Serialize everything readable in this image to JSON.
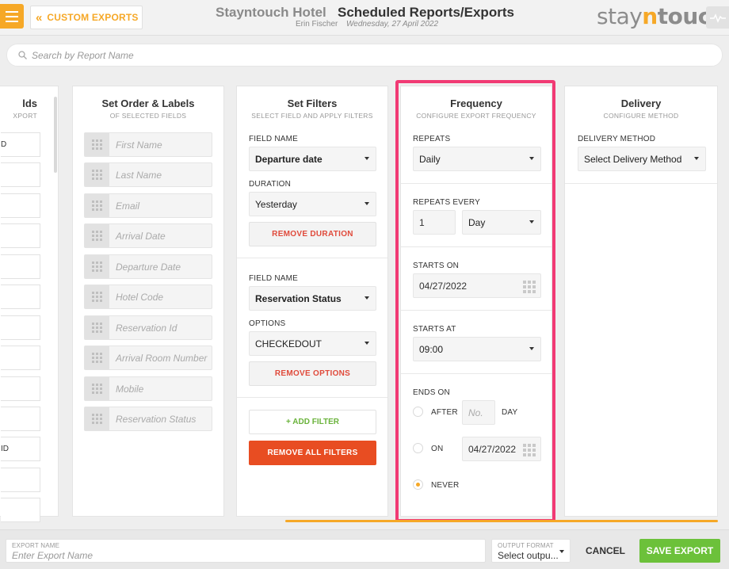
{
  "header": {
    "back_label": "CUSTOM EXPORTS",
    "hotel_name": "Stayntouch Hotel",
    "page_title": "Scheduled Reports/Exports",
    "user_name": "Erin Fischer",
    "date": "Wednesday, 27 April 2022",
    "logo": {
      "part1": "stay",
      "part2": "n",
      "part3": "touch"
    }
  },
  "search": {
    "placeholder": "Search by Report Name"
  },
  "fields_col": {
    "title_partial": "lds",
    "subtitle_partial": "XPORT",
    "items": [
      "D",
      "",
      "",
      "",
      "",
      "",
      "",
      "",
      "",
      "",
      "ID",
      "",
      ""
    ]
  },
  "order_col": {
    "title": "Set Order & Labels",
    "subtitle": "OF SELECTED FIELDS",
    "items": [
      "First Name",
      "Last Name",
      "Email",
      "Arrival Date",
      "Departure Date",
      "Hotel Code",
      "Reservation Id",
      "Arrival Room Number",
      "Mobile",
      "Reservation Status"
    ]
  },
  "filters_col": {
    "title": "Set Filters",
    "subtitle": "SELECT FIELD AND APPLY FILTERS",
    "filter1": {
      "field_label": "FIELD NAME",
      "field_value": "Departure date",
      "duration_label": "DURATION",
      "duration_value": "Yesterday",
      "remove_label": "REMOVE DURATION"
    },
    "filter2": {
      "field_label": "FIELD NAME",
      "field_value": "Reservation Status",
      "options_label": "OPTIONS",
      "options_value": "CHECKEDOUT",
      "remove_label": "REMOVE OPTIONS"
    },
    "add_filter": "+ ADD FILTER",
    "remove_all": "REMOVE ALL FILTERS"
  },
  "frequency_col": {
    "title": "Frequency",
    "subtitle": "CONFIGURE EXPORT FREQUENCY",
    "repeats_label": "REPEATS",
    "repeats_value": "Daily",
    "repeats_every_label": "REPEATS EVERY",
    "repeats_every_count": "1",
    "repeats_every_unit": "Day",
    "starts_on_label": "STARTS ON",
    "starts_on_value": "04/27/2022",
    "starts_at_label": "STARTS AT",
    "starts_at_value": "09:00",
    "ends_on_label": "ENDS ON",
    "after_label": "AFTER",
    "after_placeholder": "No.",
    "day_label": "DAY",
    "on_label": "ON",
    "on_date": "04/27/2022",
    "never_label": "NEVER",
    "selected_end": "never",
    "highlight_color": "#f13a74"
  },
  "delivery_col": {
    "title": "Delivery",
    "subtitle": "CONFIGURE METHOD",
    "method_label": "DELIVERY METHOD",
    "method_value": "Select Delivery Method"
  },
  "footer": {
    "export_name_label": "EXPORT NAME",
    "export_name_placeholder": "Enter Export Name",
    "output_format_label": "OUTPUT FORMAT",
    "output_format_value": "Select outpu...",
    "cancel_label": "CANCEL",
    "save_label": "SAVE EXPORT"
  },
  "colors": {
    "accent": "#f6a827",
    "save": "#6cc13a",
    "danger": "#e84d22",
    "remove_text": "#e04a3b"
  }
}
